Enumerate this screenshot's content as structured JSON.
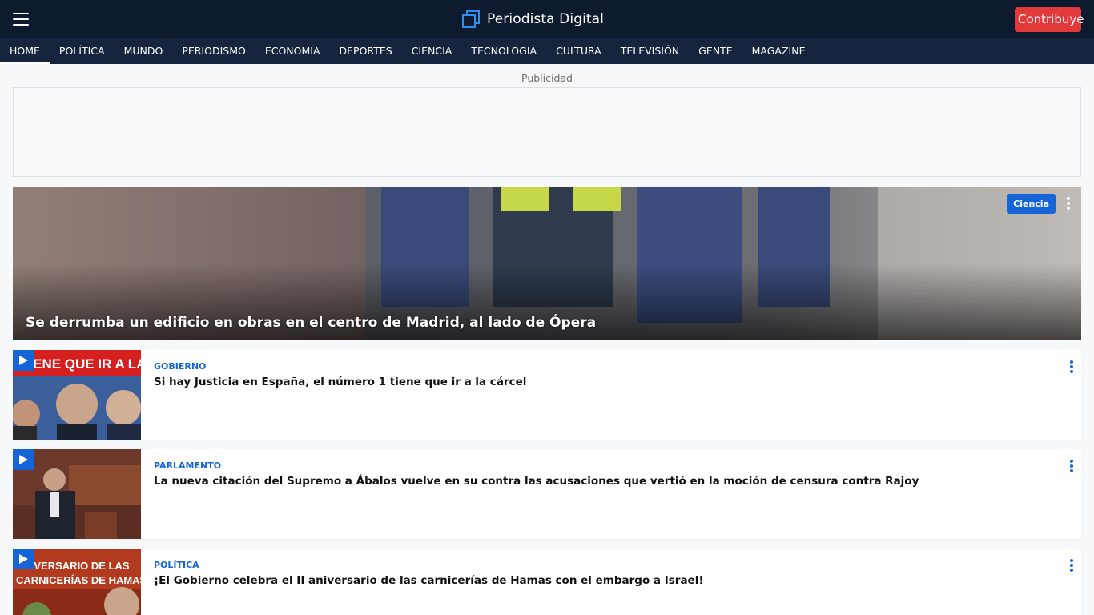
{
  "header": {
    "brand": "Periodista Digital",
    "contribute_label": "Contribuye",
    "menu_icon": "hamburger-menu-icon",
    "colors": {
      "bar": "#0e1a2e",
      "accent": "#e2393b",
      "link": "#1565d8"
    }
  },
  "nav": {
    "items": [
      "HOME",
      "POLÍTICA",
      "MUNDO",
      "PERIODISMO",
      "ECONOMÍA",
      "DEPORTES",
      "CIENCIA",
      "TECNOLOGÍA",
      "CULTURA",
      "TELEVISIÓN",
      "GENTE",
      "MAGAZINE"
    ],
    "active": "HOME"
  },
  "ad": {
    "label": "Publicidad"
  },
  "hero": {
    "title": "Se derrumba un edificio en obras en el centro de Madrid, al lado de Ópera",
    "badge": "Ciencia"
  },
  "articles": [
    {
      "category": "Gobierno",
      "title": "Si hay Justicia en España, el número 1 tiene que ir a la cárcel",
      "thumb_text": "TIENE QUE IR A LA CÁRCEL"
    },
    {
      "category": "Parlamento",
      "title": "La nueva citación del Supremo a Ábalos vuelve en su contra las acusaciones que vertió en la moción de censura contra Rajoy"
    },
    {
      "category": "Política",
      "title": "¡El Gobierno celebra el II aniversario de las carnicerías de Hamas con el embargo a Israel!",
      "thumb_text_1": "ANIVERSARIO DE LAS",
      "thumb_text_2": "CARNICERÍAS DE HAMAS"
    }
  ]
}
